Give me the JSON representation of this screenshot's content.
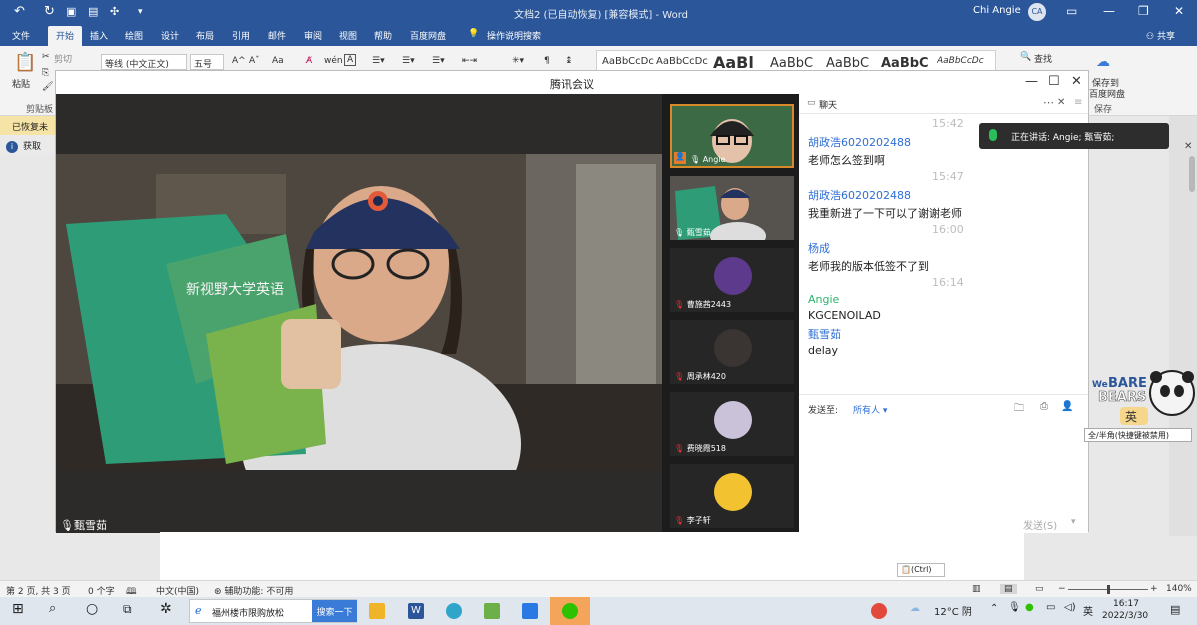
{
  "word": {
    "doc_title": "文档2 (已自动恢复) [兼容模式] - Word",
    "user_name": "Chi Angie",
    "user_initials": "CA",
    "tabs": [
      "文件",
      "开始",
      "插入",
      "绘图",
      "设计",
      "布局",
      "引用",
      "邮件",
      "审阅",
      "视图",
      "帮助",
      "百度网盘",
      "操作说明搜索"
    ],
    "share": "共享",
    "ribbon": {
      "paste": "粘贴",
      "cut": "剪切",
      "clipboard": "剪贴板",
      "font_name": "等线 (中文正文)",
      "font_size": "五号",
      "styles": [
        "AaBbCcDc",
        "AaBbCcDc",
        "AaBl",
        "AaBbC",
        "AaBbC",
        "AaBbC",
        "AaBbCcDc"
      ],
      "find": "查找",
      "save_to": "保存到",
      "baidu": "百度网盘",
      "save": "保存"
    },
    "recovered_bar": "已恢复未保",
    "info_bar": "获取",
    "status": {
      "page": "第 2 页, 共 3 页",
      "words": "0 个字",
      "lang": "中文(中国)",
      "accessibility": "辅助功能: 不可用",
      "zoom": "140%",
      "ctrl": "(Ctrl)"
    }
  },
  "meeting": {
    "title": "腾讯会议",
    "speaker_label": "甄雪茹",
    "participants": [
      {
        "name": "Angie"
      },
      {
        "name": "甄雪茹"
      },
      {
        "name": "曹施茜2443"
      },
      {
        "name": "周承林420"
      },
      {
        "name": "费晓霞518"
      },
      {
        "name": "李子轩"
      }
    ],
    "notification": "正在讲话: Angie; 甄雪茹;",
    "chat": {
      "title": "聊天",
      "messages": [
        {
          "time": "15:42",
          "sender": "胡政浩6020202488",
          "text": "老师怎么签到啊"
        },
        {
          "time": "15:47",
          "sender": "胡政浩6020202488",
          "text": "我重新进了一下可以了谢谢老师"
        },
        {
          "time": "16:00",
          "sender": "杨成",
          "text": "老师我的版本低签不了到"
        },
        {
          "time": "16:14",
          "sender": "Angie",
          "text": "KGCENOILAD"
        },
        {
          "time": "",
          "sender": "甄雪茹",
          "text": "delay"
        }
      ],
      "send_to_label": "发送至:",
      "send_to_value": "所有人",
      "send_button": "发送(S)"
    }
  },
  "overlay": {
    "bears_brand": "We BARE BEARS",
    "ime_mode": "英",
    "ime_tip": "全/半角(快捷键被禁用)"
  },
  "taskbar": {
    "search_text": "福州楼市限购放松",
    "search_btn": "搜索一下",
    "weather": "12°C 阴",
    "ime": "英",
    "time": "16:17",
    "date": "2022/3/30"
  },
  "colors": {
    "word_blue": "#2b579a",
    "chat_name": "#2f6fd6",
    "host_name": "#29b46b",
    "speaking": "#2bbd5a"
  }
}
